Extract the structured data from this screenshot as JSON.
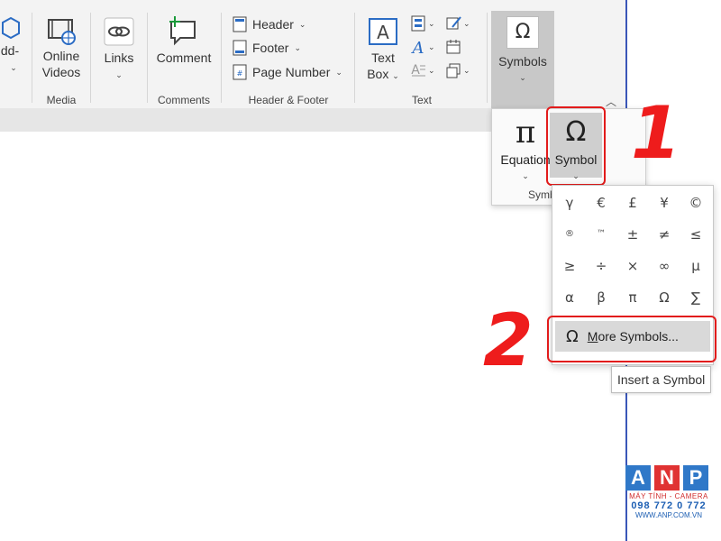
{
  "ribbon": {
    "addins_label_partial": "dd-",
    "addins_chevron": "⌄",
    "online_videos": {
      "line1": "Online",
      "line2": "Videos"
    },
    "media_group": "Media",
    "links": "Links",
    "comment": "Comment",
    "comments_group": "Comments",
    "header": "Header",
    "footer": "Footer",
    "page_number": "Page Number",
    "header_footer_group": "Header & Footer",
    "text_box": {
      "line1": "Text",
      "line2": "Box"
    },
    "text_group": "Text",
    "symbols": "Symbols"
  },
  "symbols_dropdown": {
    "equation": "Equation",
    "symbol": "Symbol",
    "group_label_partial": "Symb"
  },
  "symbol_grid": {
    "rows": [
      [
        "γ",
        "€",
        "£",
        "¥",
        "©"
      ],
      [
        "®",
        "™",
        "±",
        "≠",
        "≤"
      ],
      [
        "≥",
        "÷",
        "×",
        "∞",
        "µ"
      ],
      [
        "α",
        "β",
        "π",
        "Ω",
        "∑"
      ]
    ],
    "more_symbols": "More Symbols..."
  },
  "tooltip": "Insert a Symbol",
  "steps": {
    "one": "1",
    "two": "2"
  },
  "watermark": {
    "letters": [
      "A",
      "N",
      "P"
    ],
    "subtitle": "MÁY TÍNH - CAMERA",
    "phone": "098 772 0 772",
    "url": "WWW.ANP.COM.VN"
  },
  "colors": {
    "accent_red": "#e21b1b",
    "doc_border": "#3a56b8",
    "anp_blue": "#2f78c8",
    "anp_red": "#e03232"
  }
}
